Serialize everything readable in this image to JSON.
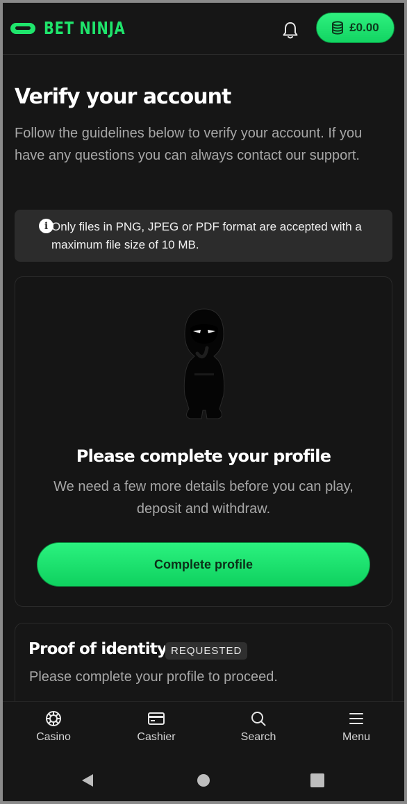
{
  "header": {
    "logo_text": "BET NINJA",
    "balance": "£0.00",
    "accent": "#1fe56c"
  },
  "main": {
    "title": "Verify your account",
    "intro": "Follow the guidelines below to verify your account. If you have any questions you can always contact our support.",
    "notice": "Only files in PNG, JPEG or PDF format are accepted with a maximum file size of 10 MB.",
    "profile_card": {
      "title": "Please complete your profile",
      "text": "We need a few more details before you can play, deposit and withdraw.",
      "button": "Complete profile"
    },
    "identity_card": {
      "title": "Proof of identity",
      "badge": "REQUESTED",
      "text": "Please complete your profile to proceed."
    }
  },
  "bottom_nav": {
    "items": [
      {
        "label": "Casino",
        "icon": "casino-chip-icon"
      },
      {
        "label": "Cashier",
        "icon": "card-icon"
      },
      {
        "label": "Search",
        "icon": "search-icon"
      },
      {
        "label": "Menu",
        "icon": "menu-icon"
      }
    ]
  },
  "system_nav": [
    "back-icon",
    "home-icon",
    "recents-icon"
  ]
}
